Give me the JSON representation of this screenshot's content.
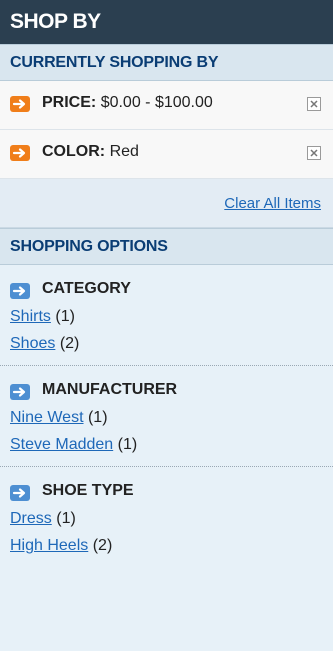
{
  "title": "SHOP BY",
  "currently_shopping_by": {
    "heading": "CURRENTLY SHOPPING BY",
    "filters": [
      {
        "label": "PRICE:",
        "value": "$0.00 - $100.00"
      },
      {
        "label": "COLOR:",
        "value": "Red"
      }
    ],
    "clear_all": "Clear All Items"
  },
  "shopping_options": {
    "heading": "SHOPPING OPTIONS",
    "groups": [
      {
        "title": "CATEGORY",
        "items": [
          {
            "label": "Shirts",
            "count": "(1)"
          },
          {
            "label": "Shoes",
            "count": "(2)"
          }
        ]
      },
      {
        "title": "MANUFACTURER",
        "items": [
          {
            "label": "Nine West",
            "count": "(1)"
          },
          {
            "label": "Steve Madden",
            "count": "(1)"
          }
        ]
      },
      {
        "title": "SHOE TYPE",
        "items": [
          {
            "label": "Dress",
            "count": "(1)"
          },
          {
            "label": "High Heels",
            "count": "(2)"
          }
        ]
      }
    ]
  },
  "colors": {
    "header_bg": "#2b3f50",
    "subhead_text": "#0a3d74",
    "link": "#1e68b8",
    "remove_icon": "#f07e1a",
    "group_arrow": "#4e8fd2"
  }
}
